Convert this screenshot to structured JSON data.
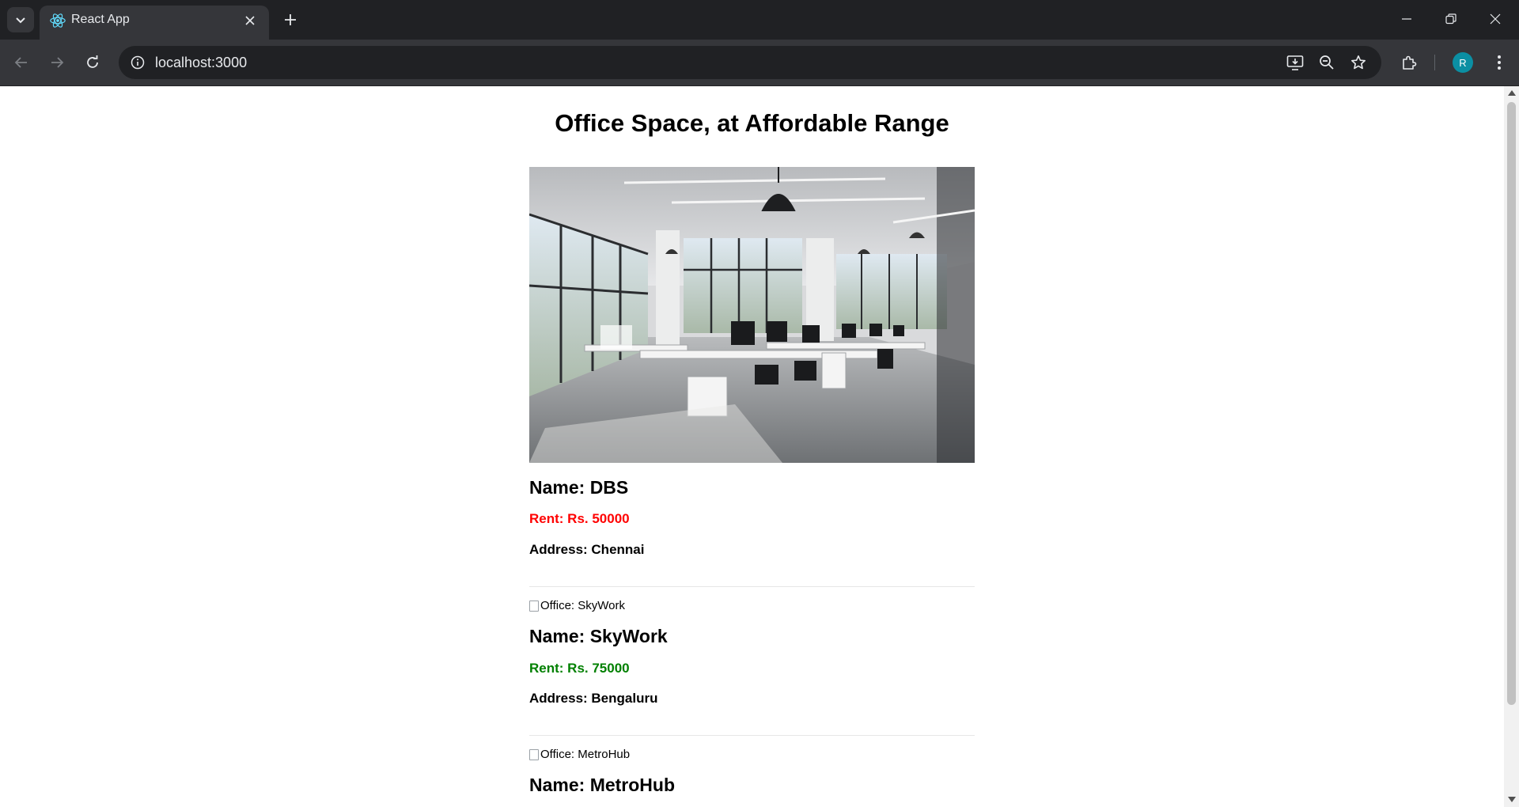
{
  "browser": {
    "tab_title": "React App",
    "url": "localhost:3000",
    "profile_initial": "R",
    "accent_color": "#0b8fa3"
  },
  "page": {
    "title": "Office Space, at Affordable Range",
    "listings": [
      {
        "image_alt": "Office: DBS",
        "image_loaded": true,
        "name": "Name: DBS",
        "rent": "Rent: Rs. 50000",
        "rent_color": "#ff0000",
        "address": "Address: Chennai"
      },
      {
        "image_alt": "Office: SkyWork",
        "image_loaded": false,
        "name": "Name: SkyWork",
        "rent": "Rent: Rs. 75000",
        "rent_color": "#008000",
        "address": "Address: Bengaluru"
      },
      {
        "image_alt": "Office: MetroHub",
        "image_loaded": false,
        "name": "Name: MetroHub"
      }
    ]
  },
  "icons": {
    "tab_search": "chevron-down-icon",
    "favicon": "react-icon",
    "close": "close-icon",
    "new_tab": "plus-icon",
    "back": "arrow-left-icon",
    "forward": "arrow-right-icon",
    "reload": "reload-icon",
    "site_info": "info-icon",
    "install": "install-app-icon",
    "zoom": "zoom-out-icon",
    "bookmark": "star-icon",
    "extensions": "puzzle-icon",
    "menu": "kebab-menu-icon"
  }
}
